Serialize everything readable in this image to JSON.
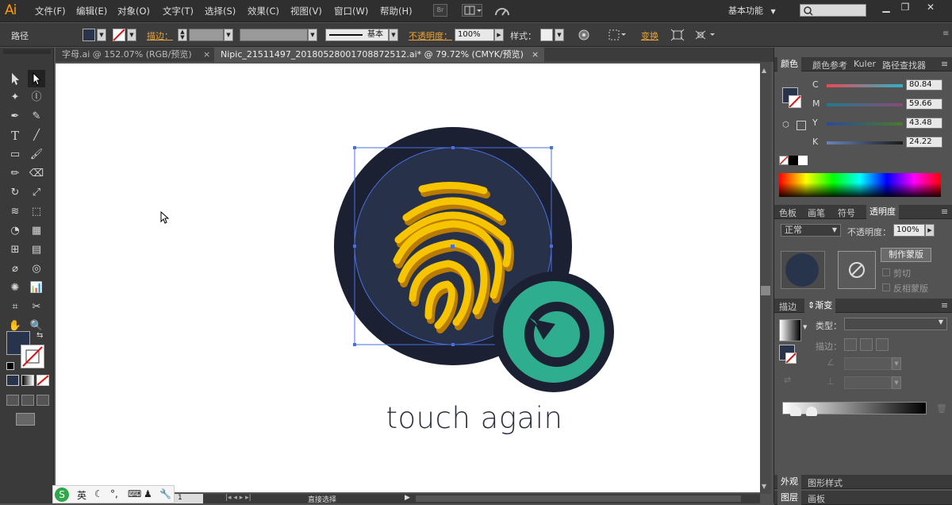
{
  "app": {
    "logo": "Ai",
    "workspace": "基本功能"
  },
  "menu": [
    "文件(F)",
    "编辑(E)",
    "对象(O)",
    "文字(T)",
    "选择(S)",
    "效果(C)",
    "视图(V)",
    "窗口(W)",
    "帮助(H)"
  ],
  "control": {
    "object_type": "路径",
    "stroke_label": "描边：",
    "stroke_style": "基本",
    "opacity_label": "不透明度：",
    "opacity_value": "100%",
    "style_label": "样式：",
    "transform_label": "变换"
  },
  "tabs": [
    {
      "label": "字母.ai @ 152.07% (RGB/预览)",
      "active": false
    },
    {
      "label": "Nipic_21511497_20180528001708872512.ai* @ 79.72% (CMYK/预览)",
      "active": true
    }
  ],
  "artwork": {
    "caption": "touch again",
    "colors": {
      "outer_circle": "#1c2233",
      "inner_circle": "#28344c",
      "fingerprint": "#f5b800",
      "badge_ring": "#1c2233",
      "badge_fill": "#2fae8f",
      "selection": "#4a6fe0"
    }
  },
  "color_panel": {
    "tabs": [
      "颜色",
      "颜色参考",
      "Kuler",
      "路径查找器"
    ],
    "channels": [
      {
        "name": "C",
        "value": "80.84"
      },
      {
        "name": "M",
        "value": "59.66"
      },
      {
        "name": "Y",
        "value": "43.48"
      },
      {
        "name": "K",
        "value": "24.22"
      }
    ]
  },
  "transparency_panel": {
    "tabs": [
      "色板",
      "画笔",
      "符号",
      "透明度"
    ],
    "blend_mode": "正常",
    "opacity_label": "不透明度：",
    "opacity_value": "100%",
    "mask_button": "制作蒙版",
    "clip_label": "剪切",
    "invert_label": "反相蒙版"
  },
  "gradient_panel": {
    "tabs": [
      "描边",
      "渐变"
    ],
    "type_label": "类型：",
    "stroke_label": "描边："
  },
  "bottom_panels": {
    "row1": [
      "外观",
      "图形样式"
    ],
    "row2": [
      "图层",
      "画板"
    ]
  },
  "status": {
    "page": "1",
    "tool": "直接选择"
  },
  "ime": {
    "lang": "英"
  }
}
